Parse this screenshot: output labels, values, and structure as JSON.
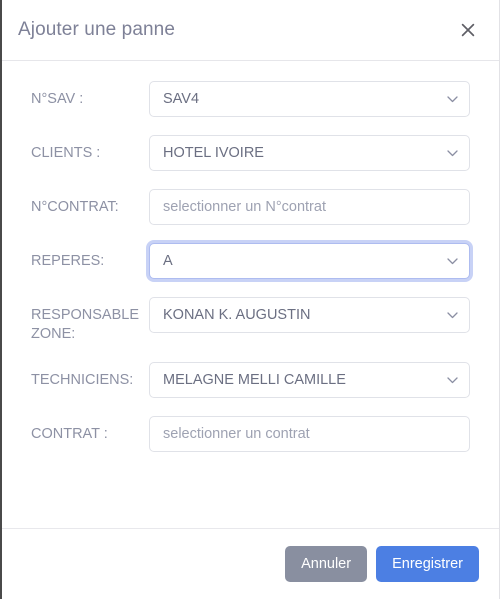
{
  "dialog": {
    "title": "Ajouter une panne",
    "close_icon": "close-icon"
  },
  "form": {
    "fields": [
      {
        "label": "N°SAV :",
        "type": "select",
        "value": "SAV4",
        "is_placeholder": false,
        "focused": false,
        "name": "numero-sav"
      },
      {
        "label": "CLIENTS :",
        "type": "select",
        "value": "HOTEL IVOIRE",
        "is_placeholder": false,
        "focused": false,
        "name": "clients"
      },
      {
        "label": "N°CONTRAT:",
        "type": "input",
        "value": "",
        "placeholder": "selectionner un N°contrat",
        "is_placeholder": true,
        "focused": false,
        "name": "numero-contrat"
      },
      {
        "label": "REPERES:",
        "type": "select",
        "value": "A",
        "is_placeholder": false,
        "focused": true,
        "name": "reperes"
      },
      {
        "label": "RESPONSABLE ZONE:",
        "type": "select",
        "value": "KONAN K. AUGUSTIN",
        "is_placeholder": false,
        "focused": false,
        "name": "responsable-zone"
      },
      {
        "label": "TECHNICIENS:",
        "type": "select",
        "value": "MELAGNE MELLI CAMILLE",
        "is_placeholder": false,
        "focused": false,
        "name": "techniciens"
      },
      {
        "label": "CONTRAT :",
        "type": "input",
        "value": "",
        "placeholder": "selectionner un contrat",
        "is_placeholder": true,
        "focused": false,
        "name": "contrat"
      }
    ]
  },
  "footer": {
    "cancel_label": "Annuler",
    "save_label": "Enregistrer"
  },
  "colors": {
    "primary": "#4c7fe3",
    "secondary": "#898fa0",
    "label_text": "#8d91a4",
    "value_text": "#6b6f82",
    "placeholder_text": "#9ea2b2",
    "title_text": "#7e8197",
    "border": "#e0e2e8",
    "focus_ring": "#c8d2f6"
  }
}
